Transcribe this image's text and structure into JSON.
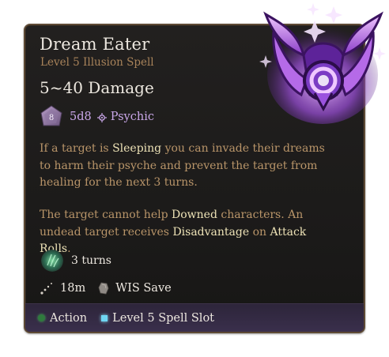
{
  "spell": {
    "name": "Dream Eater",
    "subtitle": "Level 5 Illusion Spell",
    "damage": "5~40 Damage",
    "dice": "5d8",
    "dice_face": "8",
    "damage_type": "Psychic"
  },
  "description": {
    "p1_a": "If a target is ",
    "p1_kw": "Sleeping",
    "p1_b": " you can invade their dreams to harm their psyche and prevent the target from healing for the next 3 turns.",
    "p2_a": "The target cannot help ",
    "p2_kw1": "Downed",
    "p2_b": " characters. An undead target receives ",
    "p2_kw2": "Disadvantage",
    "p2_c": " on ",
    "p2_kw3": "Attack Rolls",
    "p2_d": "."
  },
  "duration": {
    "label": "3 turns",
    "icon": "psychic-hand-icon"
  },
  "range": {
    "label": "18m",
    "icon": "range-icon"
  },
  "save": {
    "label": "WIS Save",
    "icon": "stone-icon"
  },
  "footer": {
    "action_label": "Action",
    "slot_label": "Level 5 Spell Slot"
  },
  "colors": {
    "title": "#ece7df",
    "subtitle": "#a8835a",
    "body": "#b99569",
    "keyword": "#ede2b6",
    "psychic": "#c9a7e8",
    "footer_bg": "#352c45",
    "action_dot": "#2f7a3d",
    "slot_icon": "#6fd6f2"
  }
}
